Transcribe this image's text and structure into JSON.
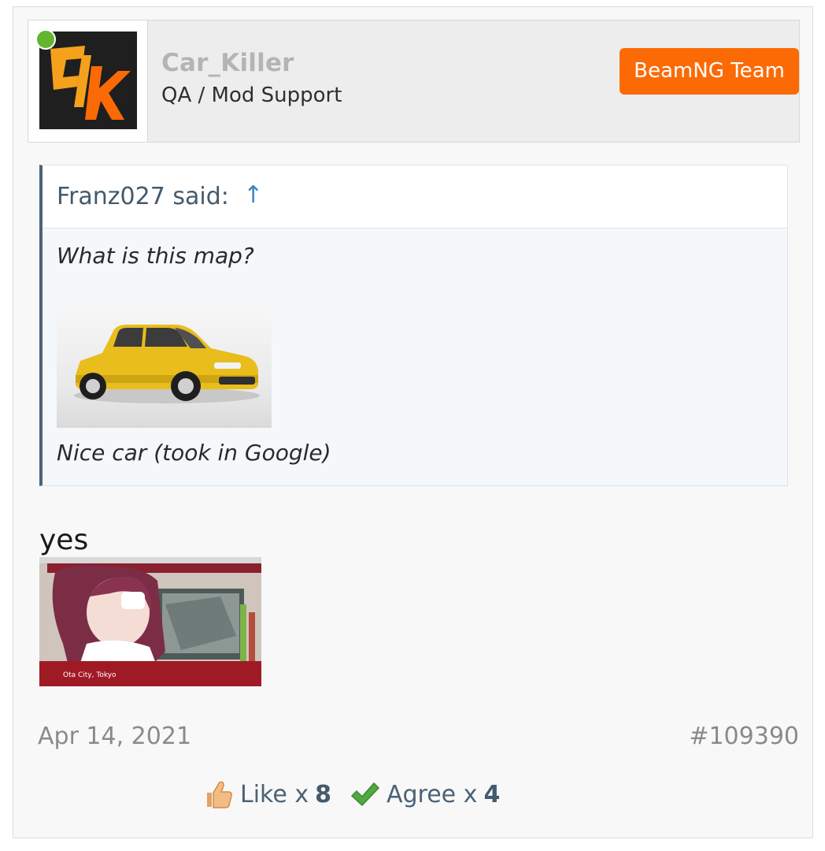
{
  "user": {
    "avatar_letters": "ck",
    "name": "Car_Killer",
    "title": "QA / Mod Support",
    "badge": "BeamNG Team",
    "online": true,
    "accent_color": "#fb6a05",
    "online_color": "#63b42f"
  },
  "quote": {
    "author": "Franz027 said:",
    "arrow_icon": "↑",
    "line1": "What is this map?",
    "image_icon": "yellow-sedan-image",
    "line2": "Nice car (took in Google)"
  },
  "reply": {
    "text": "yes",
    "image_icon": "anime-screenshot-image",
    "image_caption": "Ota City, Tokyo"
  },
  "footer": {
    "date": "Apr 14, 2021",
    "post_number": "#109390"
  },
  "reactions": [
    {
      "icon": "thumbs-up-icon",
      "label": "Like x",
      "count": "8"
    },
    {
      "icon": "checkmark-icon",
      "label": "Agree x",
      "count": "4"
    }
  ]
}
